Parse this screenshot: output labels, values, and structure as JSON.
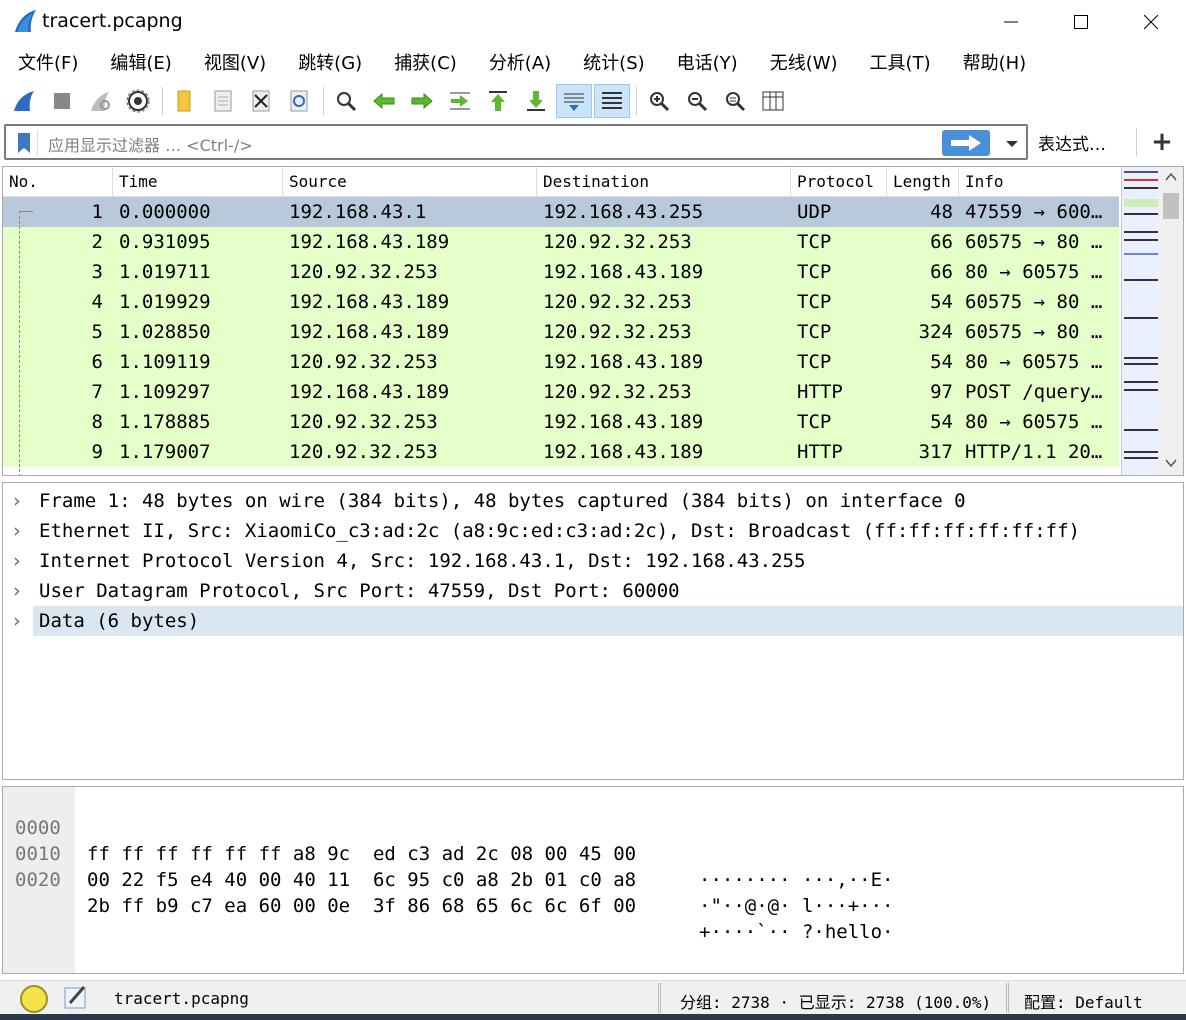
{
  "window": {
    "title": "tracert.pcapng",
    "minimize_glyph": "—",
    "maximize_glyph": "☐",
    "close_glyph": "✕"
  },
  "menu": {
    "items": [
      "文件(F)",
      "编辑(E)",
      "视图(V)",
      "跳转(G)",
      "捕获(C)",
      "分析(A)",
      "统计(S)",
      "电话(Y)",
      "无线(W)",
      "工具(T)",
      "帮助(H)"
    ]
  },
  "toolbar": {
    "icons": [
      "shark-fin-icon",
      "stop-icon",
      "restart-icon",
      "options-gear-icon",
      "open-folder-icon",
      "save-icon",
      "close-file-icon",
      "reload-icon",
      "find-icon",
      "back-arrow-icon",
      "forward-arrow-icon",
      "goto-packet-icon",
      "first-packet-icon",
      "last-packet-icon",
      "autoscroll-icon",
      "colorize-icon",
      "zoom-in-icon",
      "zoom-out-icon",
      "zoom-normal-icon",
      "resize-columns-icon"
    ]
  },
  "filter": {
    "placeholder": "应用显示过滤器 … <Ctrl-/>",
    "expression_label": "表达式…",
    "plus_label": "+"
  },
  "packet_list": {
    "columns": [
      "No.",
      "Time",
      "Source",
      "Destination",
      "Protocol",
      "Length",
      "Info"
    ],
    "rows": [
      {
        "no": "1",
        "time": "0.000000",
        "src": "192.168.43.1",
        "dst": "192.168.43.255",
        "proto": "UDP",
        "len": "48",
        "info": "47559 → 600…",
        "style": "selected"
      },
      {
        "no": "2",
        "time": "0.931095",
        "src": "192.168.43.189",
        "dst": "120.92.32.253",
        "proto": "TCP",
        "len": "66",
        "info": "60575 → 80 …",
        "style": "tcp"
      },
      {
        "no": "3",
        "time": "1.019711",
        "src": "120.92.32.253",
        "dst": "192.168.43.189",
        "proto": "TCP",
        "len": "66",
        "info": "80 → 60575 …",
        "style": "tcp"
      },
      {
        "no": "4",
        "time": "1.019929",
        "src": "192.168.43.189",
        "dst": "120.92.32.253",
        "proto": "TCP",
        "len": "54",
        "info": "60575 → 80 …",
        "style": "tcp"
      },
      {
        "no": "5",
        "time": "1.028850",
        "src": "192.168.43.189",
        "dst": "120.92.32.253",
        "proto": "TCP",
        "len": "324",
        "info": "60575 → 80 …",
        "style": "tcp"
      },
      {
        "no": "6",
        "time": "1.109119",
        "src": "120.92.32.253",
        "dst": "192.168.43.189",
        "proto": "TCP",
        "len": "54",
        "info": "80 → 60575 …",
        "style": "tcp"
      },
      {
        "no": "7",
        "time": "1.109297",
        "src": "192.168.43.189",
        "dst": "120.92.32.253",
        "proto": "HTTP",
        "len": "97",
        "info": "POST /query…",
        "style": "tcp"
      },
      {
        "no": "8",
        "time": "1.178885",
        "src": "120.92.32.253",
        "dst": "192.168.43.189",
        "proto": "TCP",
        "len": "54",
        "info": "80 → 60575 …",
        "style": "tcp"
      },
      {
        "no": "9",
        "time": "1.179007",
        "src": "120.92.32.253",
        "dst": "192.168.43.189",
        "proto": "HTTP",
        "len": "317",
        "info": "HTTP/1.1 20…",
        "style": "tcp"
      }
    ]
  },
  "details": {
    "rows": [
      {
        "text": "Frame 1: 48 bytes on wire (384 bits), 48 bytes captured (384 bits) on interface 0",
        "selected": false
      },
      {
        "text": "Ethernet II, Src: XiaomiCo_c3:ad:2c (a8:9c:ed:c3:ad:2c), Dst: Broadcast (ff:ff:ff:ff:ff:ff)",
        "selected": false
      },
      {
        "text": "Internet Protocol Version 4, Src: 192.168.43.1, Dst: 192.168.43.255",
        "selected": false
      },
      {
        "text": "User Datagram Protocol, Src Port: 47559, Dst Port: 60000",
        "selected": false
      },
      {
        "text": "Data (6 bytes)",
        "selected": true
      }
    ],
    "expander_glyph": "›"
  },
  "hex": {
    "rows": [
      {
        "offset": "0000",
        "bytes": "ff ff ff ff ff ff a8 9c  ed c3 ad 2c 08 00 45 00",
        "ascii": "········ ···,··E·"
      },
      {
        "offset": "0010",
        "bytes": "00 22 f5 e4 40 00 40 11  6c 95 c0 a8 2b 01 c0 a8",
        "ascii": "·\"··@·@· l···+···"
      },
      {
        "offset": "0020",
        "bytes": "2b ff b9 c7 ea 60 00 0e  3f 86 68 65 6c 6c 6f 00",
        "ascii": "+····`·· ?·hello·"
      }
    ]
  },
  "status": {
    "filename": "tracert.pcapng",
    "counts": "分组: 2738 · 已显示: 2738 (100.0%)",
    "profile": "配置: Default"
  },
  "colors": {
    "selected_row": "#b8c9db",
    "tcp_row": "#e4ffc7",
    "detail_selected": "#dae6f2",
    "filter_apply": "#4a90d9"
  }
}
